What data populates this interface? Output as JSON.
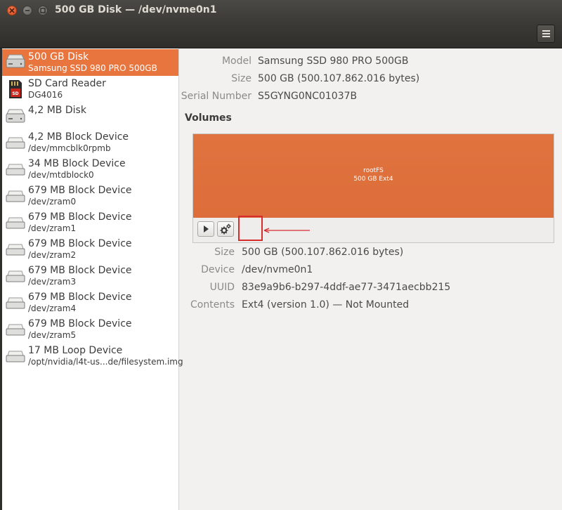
{
  "window": {
    "title": "500 GB Disk — /dev/nvme0n1"
  },
  "header": {
    "menu_icon": "hamburger-menu-icon"
  },
  "sidebar": {
    "items": [
      {
        "name": "500 GB Disk",
        "sub": "Samsung SSD 980 PRO 500GB",
        "icon": "hard-disk-icon",
        "selected": true
      },
      {
        "name": "SD Card Reader",
        "sub": "DG4016",
        "icon": "sd-card-icon",
        "selected": false
      },
      {
        "name": "4,2 MB Disk",
        "sub": "",
        "icon": "hard-disk-icon",
        "selected": false
      },
      {
        "name": "4,2 MB Block Device",
        "sub": "/dev/mmcblk0rpmb",
        "icon": "drive-icon",
        "selected": false
      },
      {
        "name": "34 MB Block Device",
        "sub": "/dev/mtdblock0",
        "icon": "drive-icon",
        "selected": false
      },
      {
        "name": "679 MB Block Device",
        "sub": "/dev/zram0",
        "icon": "drive-icon",
        "selected": false
      },
      {
        "name": "679 MB Block Device",
        "sub": "/dev/zram1",
        "icon": "drive-icon",
        "selected": false
      },
      {
        "name": "679 MB Block Device",
        "sub": "/dev/zram2",
        "icon": "drive-icon",
        "selected": false
      },
      {
        "name": "679 MB Block Device",
        "sub": "/dev/zram3",
        "icon": "drive-icon",
        "selected": false
      },
      {
        "name": "679 MB Block Device",
        "sub": "/dev/zram4",
        "icon": "drive-icon",
        "selected": false
      },
      {
        "name": "679 MB Block Device",
        "sub": "/dev/zram5",
        "icon": "drive-icon",
        "selected": false
      },
      {
        "name": "17 MB Loop Device",
        "sub": "/opt/nvidia/l4t-us...de/filesystem.img",
        "icon": "drive-icon",
        "selected": false
      }
    ]
  },
  "disk": {
    "model_label": "Model",
    "model": "Samsung SSD 980 PRO 500GB",
    "size_label": "Size",
    "size": "500 GB (500.107.862.016 bytes)",
    "serial_label": "Serial Number",
    "serial": "S5GYNG0NC01037B"
  },
  "volumes": {
    "title": "Volumes",
    "partition": {
      "line1": "rootFS",
      "line2": "500 GB Ext4",
      "color": "#e0733f"
    },
    "toolbar": {
      "mount_icon": "play-icon",
      "settings_icon": "gears-icon"
    }
  },
  "partition_details": {
    "size_label": "Size",
    "size": "500 GB (500.107.862.016 bytes)",
    "device_label": "Device",
    "device": "/dev/nvme0n1",
    "uuid_label": "UUID",
    "uuid": "83e9a9b6-b297-4ddf-ae77-3471aecbb215",
    "contents_label": "Contents",
    "contents": "Ext4 (version 1.0) — Not Mounted"
  },
  "colors": {
    "accent": "#e9753e",
    "annotation": "#d62c2c"
  }
}
